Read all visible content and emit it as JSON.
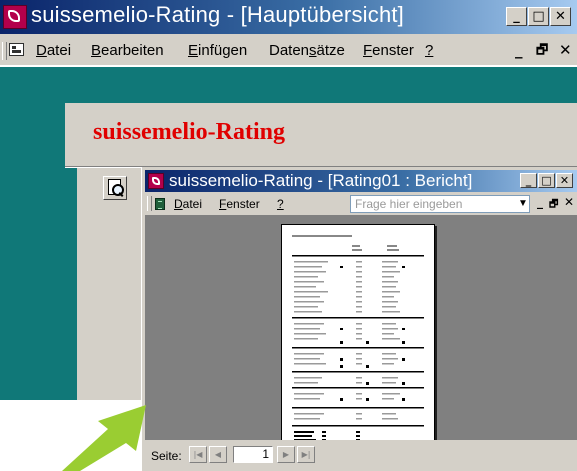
{
  "outer_window": {
    "title": "suissemelio-Rating - [Hauptübersicht]",
    "menu": [
      {
        "label": "Datei",
        "key": "D",
        "rest": "atei"
      },
      {
        "label": "Bearbeiten",
        "key": "B",
        "rest": "earbeiten"
      },
      {
        "label": "Einfügen",
        "key": "E",
        "rest": "infügen"
      },
      {
        "label": "Datensätze",
        "pre": "Daten",
        "key": "s",
        "rest": "ätze"
      },
      {
        "label": "Fenster",
        "key": "F",
        "rest": "enster"
      },
      {
        "label": "?",
        "key": "?",
        "rest": ""
      }
    ],
    "controls": {
      "minimize": "_",
      "maximize": "□",
      "close": "✕"
    },
    "mdi_controls": {
      "minimize": "_",
      "restore": "🗗",
      "close": "✕"
    }
  },
  "form": {
    "heading": "suissemelio-Rating",
    "teal_color": "#107878",
    "heading_color": "#e00000"
  },
  "report_window": {
    "title": "suissemelio-Rating - [Rating01 : Bericht]",
    "menu": [
      {
        "label": "Datei",
        "key": "D",
        "rest": "atei"
      },
      {
        "label": "Fenster",
        "key": "F",
        "rest": "enster"
      },
      {
        "label": "?",
        "key": "?",
        "rest": ""
      }
    ],
    "help_placeholder": "Frage hier eingeben",
    "navigation": {
      "page_label": "Seite:",
      "current_page": "1",
      "buttons": [
        "first",
        "previous",
        "next",
        "last"
      ]
    }
  },
  "icons": [
    "app-icon",
    "form-icon",
    "print-preview-icon",
    "report-icon",
    "dropdown-arrow-icon",
    "green-arrow"
  ],
  "arrow_color": "#9acd32"
}
